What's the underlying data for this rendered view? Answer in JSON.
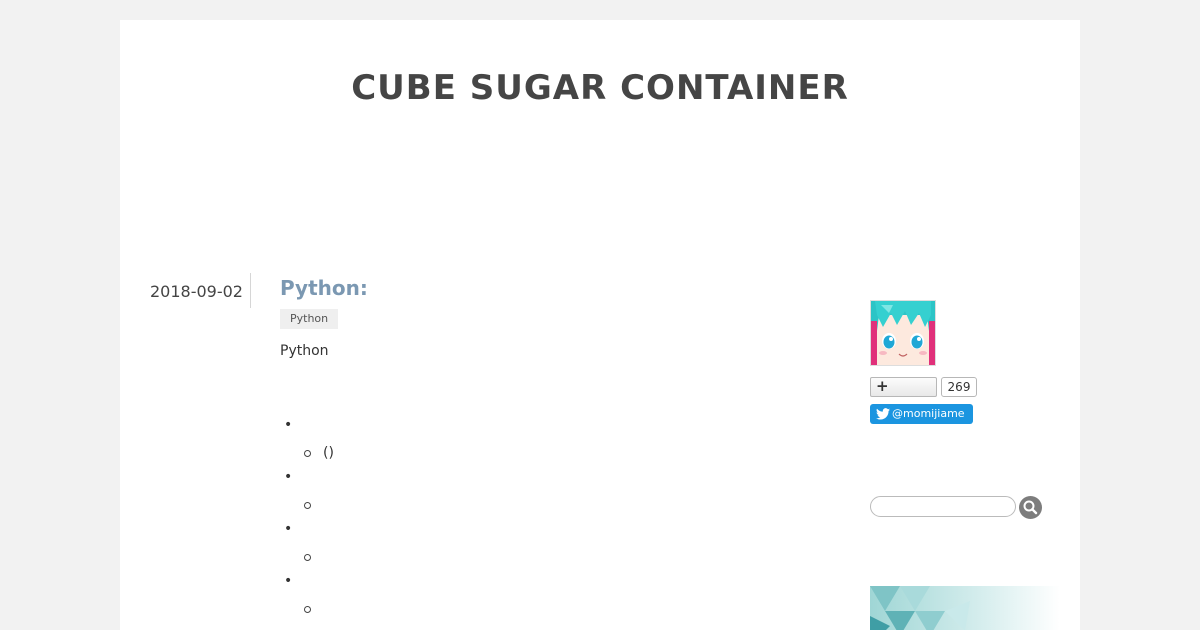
{
  "site": {
    "title": "CUBE SUGAR CONTAINER"
  },
  "post": {
    "date": "2018-09-02",
    "title": "Python:",
    "category": "Python",
    "summary": "Python",
    "toc": [
      {
        "label": "",
        "sub": [
          "()"
        ]
      },
      {
        "label": "",
        "sub": [
          ""
        ]
      },
      {
        "label": "",
        "sub": [
          ""
        ]
      },
      {
        "label": "",
        "sub": [
          ""
        ]
      }
    ]
  },
  "sidebar": {
    "subscriber_count": "269",
    "twitter_handle": "@momijiame",
    "search": {
      "placeholder": ""
    }
  },
  "colors": {
    "page_bg": "#f2f2f2",
    "title_color": "#454545",
    "post_title_color": "#7b98b2",
    "twitter_blue": "#1b95e0"
  },
  "icons": [
    "plus-icon",
    "twitter-bird-icon",
    "magnifier-icon"
  ]
}
